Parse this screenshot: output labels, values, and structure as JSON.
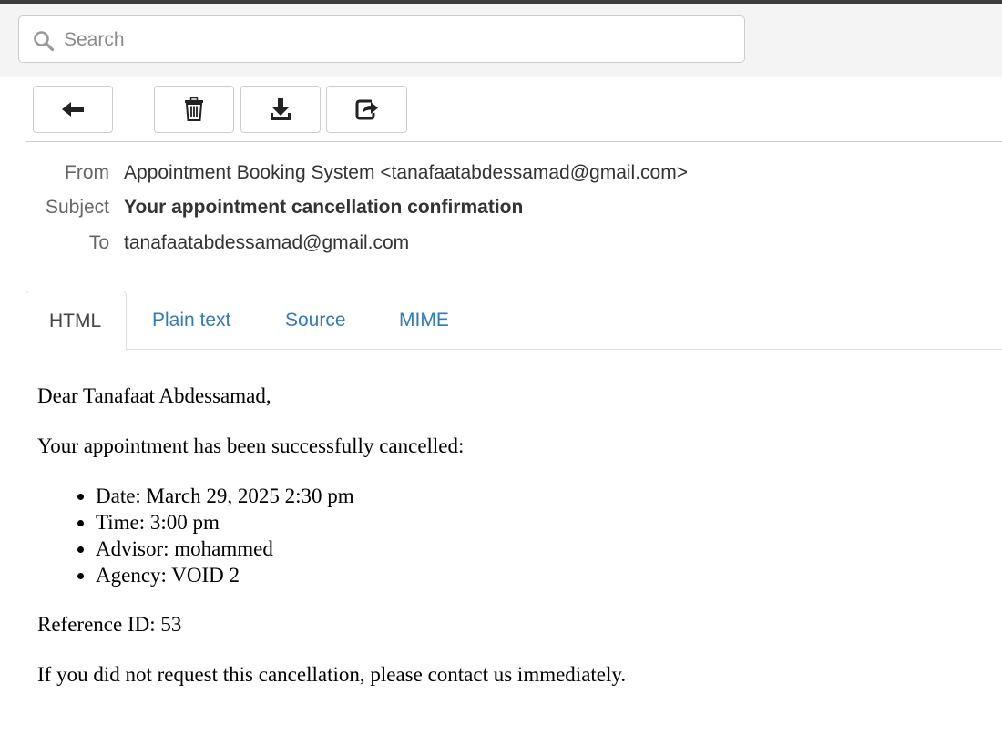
{
  "search": {
    "placeholder": "Search"
  },
  "toolbar": {
    "back_icon": "arrow-left-icon",
    "delete_icon": "trash-icon",
    "download_icon": "download-icon",
    "forward_icon": "share-icon"
  },
  "headers": {
    "from_label": "From",
    "from_value": "Appointment Booking System <tanafaatabdessamad@gmail.com>",
    "subject_label": "Subject",
    "subject_value": "Your appointment cancellation confirmation",
    "to_label": "To",
    "to_value": "tanafaatabdessamad@gmail.com"
  },
  "tabs": [
    {
      "label": "HTML",
      "active": true
    },
    {
      "label": "Plain text",
      "active": false
    },
    {
      "label": "Source",
      "active": false
    },
    {
      "label": "MIME",
      "active": false
    }
  ],
  "message": {
    "greeting": "Dear Tanafaat Abdessamad,",
    "intro": "Your appointment has been successfully cancelled:",
    "details": [
      "Date: March 29, 2025 2:30 pm",
      "Time: 3:00 pm",
      "Advisor: mohammed",
      "Agency: VOID 2"
    ],
    "reference": "Reference ID: 53",
    "closing": "If you did not request this cancellation, please contact us immediately."
  },
  "colors": {
    "link": "#337ab7",
    "label": "#666666",
    "text": "#333333",
    "border": "#cccccc"
  }
}
